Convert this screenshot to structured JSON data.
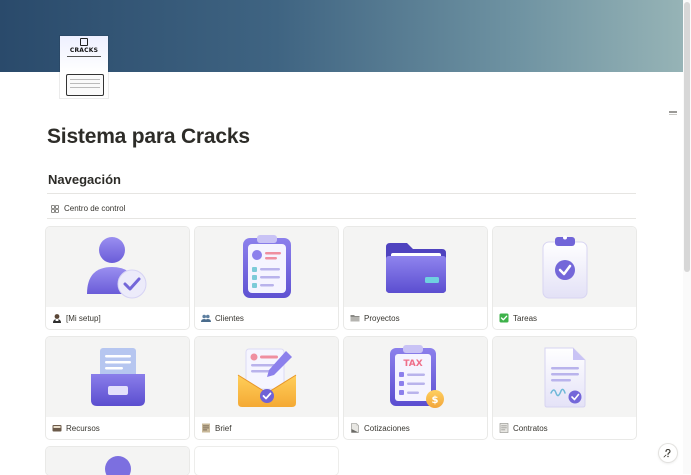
{
  "page": {
    "icon_text": "CRACKS",
    "title": "Sistema para Cracks"
  },
  "navigation": {
    "heading": "Navegación",
    "view_tab": "Centro de control",
    "cards": [
      {
        "label": "[Mi setup]",
        "emoji": "person-icon",
        "image": "user-check-icon"
      },
      {
        "label": "Clientes",
        "emoji": "people-icon",
        "image": "clipboard-profile-icon"
      },
      {
        "label": "Proyectos",
        "emoji": "folder-icon",
        "image": "folder-icon"
      },
      {
        "label": "Tareas",
        "emoji": "check-mark-icon",
        "image": "clipboard-check-icon"
      },
      {
        "label": "Recursos",
        "emoji": "card-index-icon",
        "image": "inbox-tray-icon"
      },
      {
        "label": "Brief",
        "emoji": "notepad-icon",
        "image": "envelope-letter-icon"
      },
      {
        "label": "Cotizaciones",
        "emoji": "page-icon",
        "image": "tax-clipboard-icon",
        "image_text": "TAX"
      },
      {
        "label": "Contratos",
        "emoji": "memo-icon",
        "image": "signed-document-icon"
      }
    ]
  },
  "colors": {
    "accent_purple": "#7c6fe0",
    "cover_start": "#2a4a6b",
    "cover_end": "#98b5b7"
  }
}
